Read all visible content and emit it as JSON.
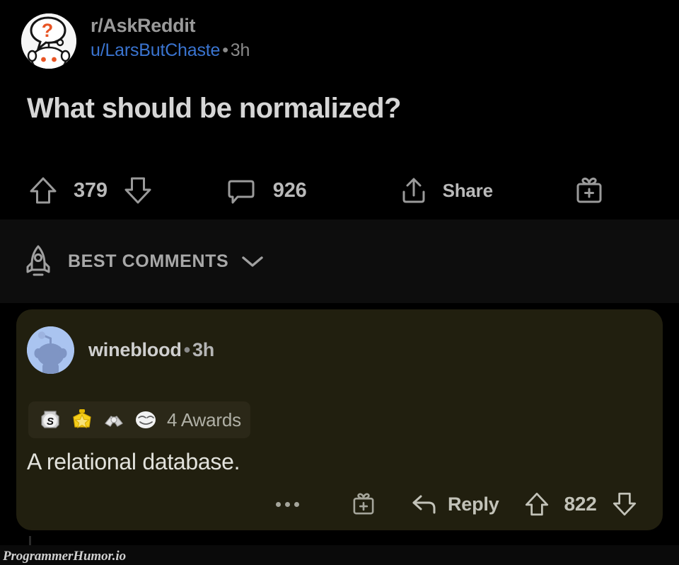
{
  "post": {
    "subreddit": "r/AskReddit",
    "author": "u/LarsButChaste",
    "separator": "•",
    "age": "3h",
    "title": "What should be normalized?",
    "upvote_icon": "upvote-arrow-icon",
    "score": "379",
    "downvote_icon": "downvote-arrow-icon",
    "comment_icon": "comment-bubble-icon",
    "comment_count": "926",
    "share_icon": "share-icon",
    "share_label": "Share",
    "award_icon": "gift-award-icon"
  },
  "sort": {
    "icon": "rocket-icon",
    "label": "BEST COMMENTS",
    "chevron": "chevron-down-icon"
  },
  "comment": {
    "author": "wineblood",
    "separator": "•",
    "age": "3h",
    "awards": [
      {
        "name": "silver-award",
        "label": "S"
      },
      {
        "name": "gold-star-award",
        "label": "star"
      },
      {
        "name": "handshake-award",
        "label": "handshake"
      },
      {
        "name": "face-award",
        "label": "face"
      }
    ],
    "awards_count": "4 Awards",
    "body": "A relational database.",
    "overflow_icon": "more-options-icon",
    "gift_icon": "gift-award-icon",
    "reply_icon": "reply-arrow-icon",
    "reply_label": "Reply",
    "upvote_icon": "upvote-arrow-icon",
    "score": "822",
    "downvote_icon": "downvote-arrow-icon"
  },
  "watermark": {
    "text": "ProgrammerHumor.io"
  },
  "colors": {
    "background": "#000000",
    "sort_bar": "#0d0d0d",
    "comment_card": "#211f0f",
    "awards_pill": "#2b2818",
    "link_blue": "#3a74d0",
    "title_gray": "#d6d6d6",
    "muted_gray": "#8a8a8a",
    "question_orange": "#e85424"
  }
}
